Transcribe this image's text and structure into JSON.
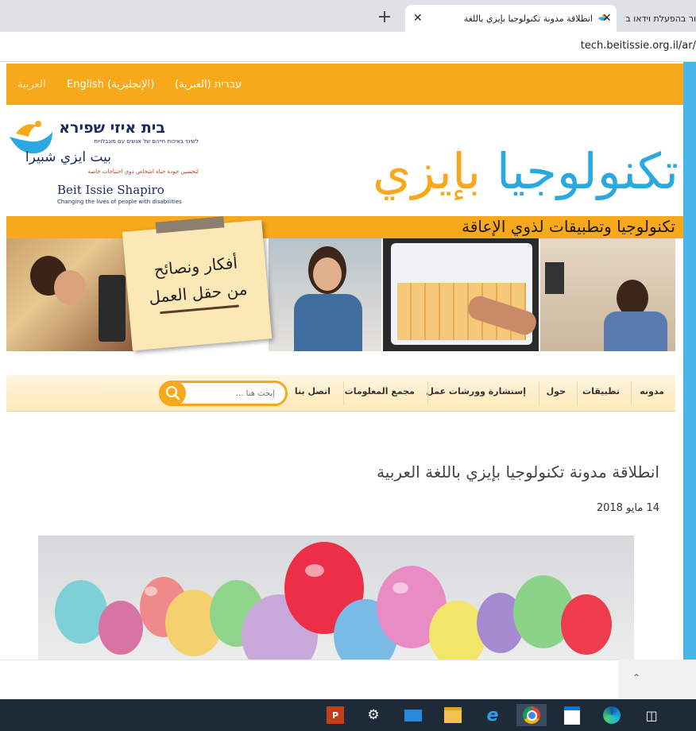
{
  "browser": {
    "tabs": [
      {
        "title": "انطلاقة مدونة تكنولوجيا بإيزي باللغة",
        "active": true
      },
      {
        "title": "ור בהפעלת וידאו ב",
        "active": false
      }
    ],
    "new_tab": "+",
    "close_glyph": "✕",
    "url": "tech.beitissie.org.il/ar/"
  },
  "lang_bar": {
    "items": [
      "עברית (العبرية)",
      "English (الإنجليزية)",
      "العربية"
    ]
  },
  "logo": {
    "hebrew": "בית איזי שפירא",
    "hebrew_tagline": "לשינוי באיכות חייהם של אנשים עם מוגבלויות",
    "arabic": "بيت ايزي شبيرا",
    "arabic_tagline": "لتحسين جودة حياة اشخاص ذوي احتياجات خاصة",
    "english": "Beit Issie Shapiro",
    "english_tagline": "Changing the lives of people with disabilities"
  },
  "site_title": {
    "part1": "تكنولوجيا",
    "part2": "بإيزي"
  },
  "subtitle": "تكنولوجيا وتطبيقات لذوي الإعاقة",
  "note": {
    "line1": "أفكار ونصائح",
    "line2": "من حقل العمل"
  },
  "nav": {
    "items": [
      "مدونه",
      "تطبيقات",
      "حول",
      "إستشارة وورشات عمل",
      "مجمع المعلومات",
      "اتصل بنا"
    ],
    "search_placeholder": "إبحث هنا ..."
  },
  "post": {
    "title": "انطلاقة مدونة تكنولوجيا بإيزي باللغة العربية",
    "date": "14 مايو 2018"
  },
  "colors": {
    "orange": "#f7a81b",
    "blue": "#2aa8e0",
    "navy": "#1a2b5c"
  },
  "taskbar": {
    "icons": [
      "powerpoint-icon",
      "settings-icon",
      "mail-icon",
      "file-explorer-icon",
      "internet-explorer-icon",
      "chrome-icon",
      "store-icon",
      "edge-icon",
      "task-view-icon"
    ]
  }
}
